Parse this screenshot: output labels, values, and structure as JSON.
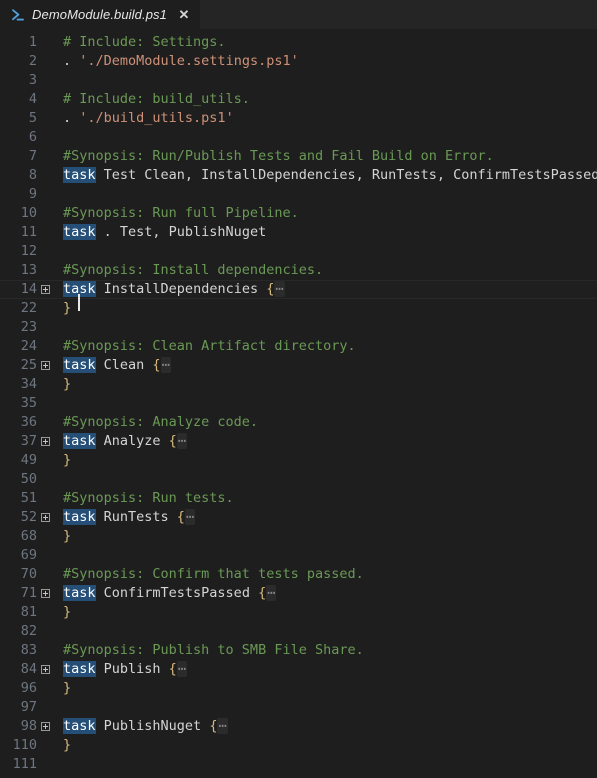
{
  "window": {
    "background": "#1e1e1e",
    "tabbar_background": "#252526"
  },
  "tabbar": {
    "tabs": [
      {
        "label": "DemoModule.build.ps1",
        "icon": "powershell-icon",
        "active": true,
        "dirty": false,
        "close_label": "✕"
      }
    ]
  },
  "colors": {
    "comment": "#6a9955",
    "string": "#ce9178",
    "plain": "#d4d4d4",
    "keyword_highlight_bg": "#264f78",
    "keyword_highlight_fg": "#ffffff",
    "brace": "#d7ba7d",
    "line_number": "#6e7681",
    "fold_placeholder": "#8a8a8a"
  },
  "editor": {
    "language": "PowerShell",
    "file_name": "DemoModule.build.ps1",
    "cursor_line": 14,
    "cursor_column": 3,
    "last_line_number": 111,
    "fold_placeholder": "⋯",
    "lines": [
      {
        "num": "1",
        "fold": false,
        "current": false,
        "tokens": [
          {
            "c": "comment",
            "t": "# Include: Settings."
          }
        ]
      },
      {
        "num": "2",
        "fold": false,
        "current": false,
        "tokens": [
          {
            "c": "op",
            "t": ". "
          },
          {
            "c": "string",
            "t": "'./DemoModule.settings.ps1'"
          }
        ]
      },
      {
        "num": "3",
        "fold": false,
        "current": false,
        "tokens": []
      },
      {
        "num": "4",
        "fold": false,
        "current": false,
        "tokens": [
          {
            "c": "comment",
            "t": "# Include: build_utils."
          }
        ]
      },
      {
        "num": "5",
        "fold": false,
        "current": false,
        "tokens": [
          {
            "c": "op",
            "t": ". "
          },
          {
            "c": "string",
            "t": "'./build_utils.ps1'"
          }
        ]
      },
      {
        "num": "6",
        "fold": false,
        "current": false,
        "tokens": []
      },
      {
        "num": "7",
        "fold": false,
        "current": false,
        "tokens": [
          {
            "c": "comment",
            "t": "#Synopsis: Run/Publish Tests and Fail Build on Error."
          }
        ]
      },
      {
        "num": "8",
        "fold": false,
        "current": false,
        "tokens": [
          {
            "c": "kw",
            "t": "task"
          },
          {
            "c": "plain",
            "t": " Test Clean, InstallDependencies, RunTests, ConfirmTestsPassed"
          }
        ]
      },
      {
        "num": "9",
        "fold": false,
        "current": false,
        "tokens": []
      },
      {
        "num": "10",
        "fold": false,
        "current": false,
        "tokens": [
          {
            "c": "comment",
            "t": "#Synopsis: Run full Pipeline."
          }
        ]
      },
      {
        "num": "11",
        "fold": false,
        "current": false,
        "tokens": [
          {
            "c": "kw",
            "t": "task"
          },
          {
            "c": "plain",
            "t": " . Test, PublishNuget"
          }
        ]
      },
      {
        "num": "12",
        "fold": false,
        "current": false,
        "tokens": []
      },
      {
        "num": "13",
        "fold": false,
        "current": false,
        "tokens": [
          {
            "c": "comment",
            "t": "#Synopsis: Install dependencies."
          }
        ]
      },
      {
        "num": "14",
        "fold": true,
        "current": true,
        "tokens": [
          {
            "c": "kw",
            "t": "task",
            "caret_after": 2
          },
          {
            "c": "plain",
            "t": " InstallDependencies "
          },
          {
            "c": "brace",
            "t": "{"
          },
          {
            "c": "foldmark",
            "t": "⋯"
          }
        ]
      },
      {
        "num": "22",
        "fold": false,
        "current": false,
        "tokens": [
          {
            "c": "brace",
            "t": "}"
          }
        ]
      },
      {
        "num": "23",
        "fold": false,
        "current": false,
        "tokens": []
      },
      {
        "num": "24",
        "fold": false,
        "current": false,
        "tokens": [
          {
            "c": "comment",
            "t": "#Synopsis: Clean Artifact directory."
          }
        ]
      },
      {
        "num": "25",
        "fold": true,
        "current": false,
        "tokens": [
          {
            "c": "kw",
            "t": "task"
          },
          {
            "c": "plain",
            "t": " Clean "
          },
          {
            "c": "brace",
            "t": "{"
          },
          {
            "c": "foldmark",
            "t": "⋯"
          }
        ]
      },
      {
        "num": "34",
        "fold": false,
        "current": false,
        "tokens": [
          {
            "c": "brace",
            "t": "}"
          }
        ]
      },
      {
        "num": "35",
        "fold": false,
        "current": false,
        "tokens": []
      },
      {
        "num": "36",
        "fold": false,
        "current": false,
        "tokens": [
          {
            "c": "comment",
            "t": "#Synopsis: Analyze code."
          }
        ]
      },
      {
        "num": "37",
        "fold": true,
        "current": false,
        "tokens": [
          {
            "c": "kw",
            "t": "task"
          },
          {
            "c": "plain",
            "t": " Analyze "
          },
          {
            "c": "brace",
            "t": "{"
          },
          {
            "c": "foldmark",
            "t": "⋯"
          }
        ]
      },
      {
        "num": "49",
        "fold": false,
        "current": false,
        "tokens": [
          {
            "c": "brace",
            "t": "}"
          }
        ]
      },
      {
        "num": "50",
        "fold": false,
        "current": false,
        "tokens": []
      },
      {
        "num": "51",
        "fold": false,
        "current": false,
        "tokens": [
          {
            "c": "comment",
            "t": "#Synopsis: Run tests."
          }
        ]
      },
      {
        "num": "52",
        "fold": true,
        "current": false,
        "tokens": [
          {
            "c": "kw",
            "t": "task"
          },
          {
            "c": "plain",
            "t": " RunTests "
          },
          {
            "c": "brace",
            "t": "{"
          },
          {
            "c": "foldmark",
            "t": "⋯"
          }
        ]
      },
      {
        "num": "68",
        "fold": false,
        "current": false,
        "tokens": [
          {
            "c": "brace",
            "t": "}"
          }
        ]
      },
      {
        "num": "69",
        "fold": false,
        "current": false,
        "tokens": []
      },
      {
        "num": "70",
        "fold": false,
        "current": false,
        "tokens": [
          {
            "c": "comment",
            "t": "#Synopsis: Confirm that tests passed."
          }
        ]
      },
      {
        "num": "71",
        "fold": true,
        "current": false,
        "tokens": [
          {
            "c": "kw",
            "t": "task"
          },
          {
            "c": "plain",
            "t": " ConfirmTestsPassed "
          },
          {
            "c": "brace",
            "t": "{"
          },
          {
            "c": "foldmark",
            "t": "⋯"
          }
        ]
      },
      {
        "num": "81",
        "fold": false,
        "current": false,
        "tokens": [
          {
            "c": "brace",
            "t": "}"
          }
        ]
      },
      {
        "num": "82",
        "fold": false,
        "current": false,
        "tokens": []
      },
      {
        "num": "83",
        "fold": false,
        "current": false,
        "tokens": [
          {
            "c": "comment",
            "t": "#Synopsis: Publish to SMB File Share."
          }
        ]
      },
      {
        "num": "84",
        "fold": true,
        "current": false,
        "tokens": [
          {
            "c": "kw",
            "t": "task"
          },
          {
            "c": "plain",
            "t": " Publish "
          },
          {
            "c": "brace",
            "t": "{"
          },
          {
            "c": "foldmark",
            "t": "⋯"
          }
        ]
      },
      {
        "num": "96",
        "fold": false,
        "current": false,
        "tokens": [
          {
            "c": "brace",
            "t": "}"
          }
        ]
      },
      {
        "num": "97",
        "fold": false,
        "current": false,
        "tokens": []
      },
      {
        "num": "98",
        "fold": true,
        "current": false,
        "tokens": [
          {
            "c": "kw",
            "t": "task"
          },
          {
            "c": "plain",
            "t": " PublishNuget "
          },
          {
            "c": "brace",
            "t": "{"
          },
          {
            "c": "foldmark",
            "t": "⋯"
          }
        ]
      },
      {
        "num": "110",
        "fold": false,
        "current": false,
        "tokens": [
          {
            "c": "brace",
            "t": "}"
          }
        ]
      },
      {
        "num": "111",
        "fold": false,
        "current": false,
        "tokens": []
      }
    ]
  }
}
